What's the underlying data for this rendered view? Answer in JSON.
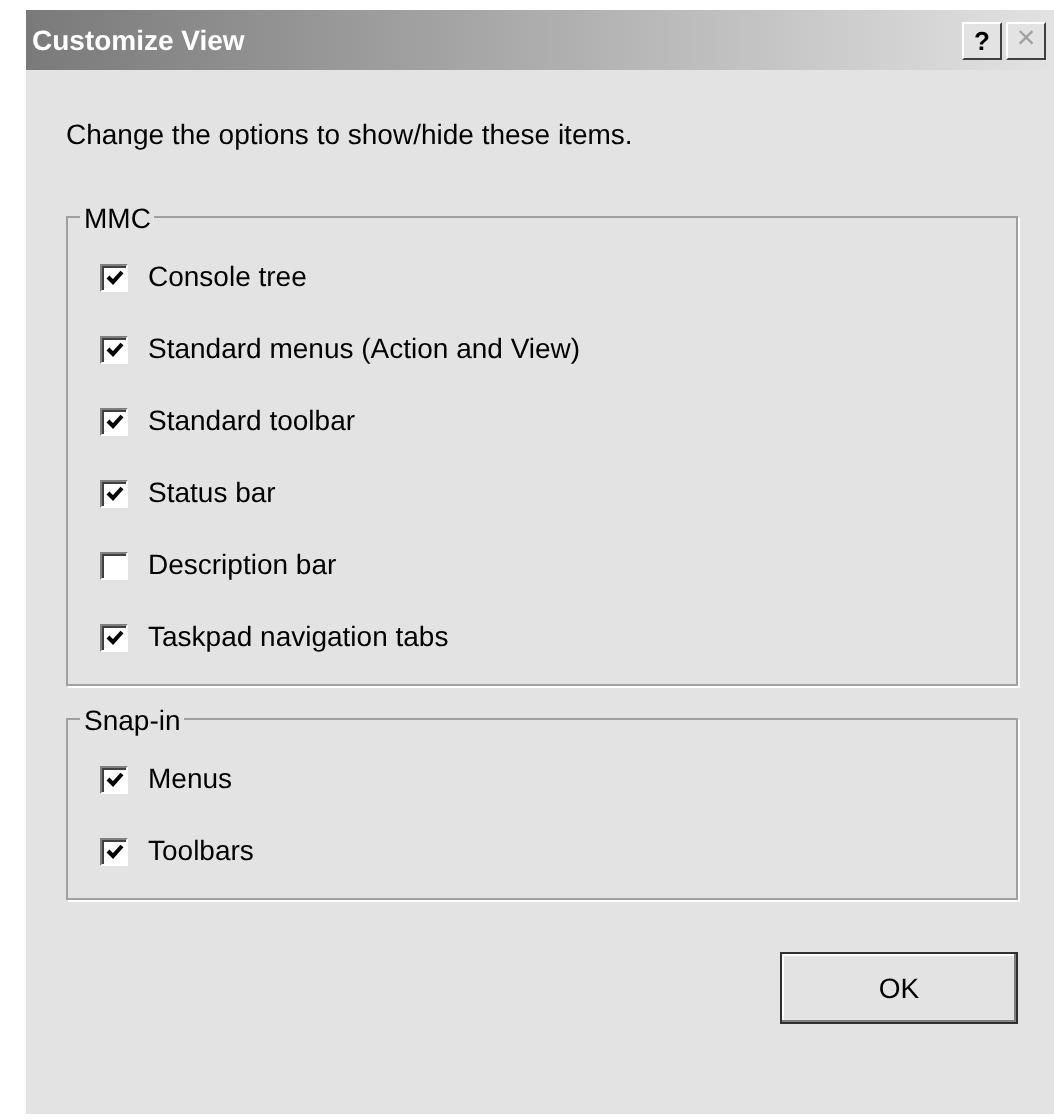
{
  "window": {
    "title": "Customize View",
    "help_button": "?",
    "close_button": {
      "label": "×",
      "disabled": true
    }
  },
  "instruction": "Change the options to show/hide these items.",
  "groups": [
    {
      "title": "MMC",
      "options": [
        {
          "label": "Console tree",
          "checked": true
        },
        {
          "label": "Standard menus (Action and View)",
          "checked": true
        },
        {
          "label": "Standard toolbar",
          "checked": true
        },
        {
          "label": "Status bar",
          "checked": true
        },
        {
          "label": "Description bar",
          "checked": false
        },
        {
          "label": "Taskpad navigation tabs",
          "checked": true
        }
      ]
    },
    {
      "title": "Snap-in",
      "options": [
        {
          "label": "Menus",
          "checked": true
        },
        {
          "label": "Toolbars",
          "checked": true
        }
      ]
    }
  ],
  "buttons": [
    "OK"
  ]
}
